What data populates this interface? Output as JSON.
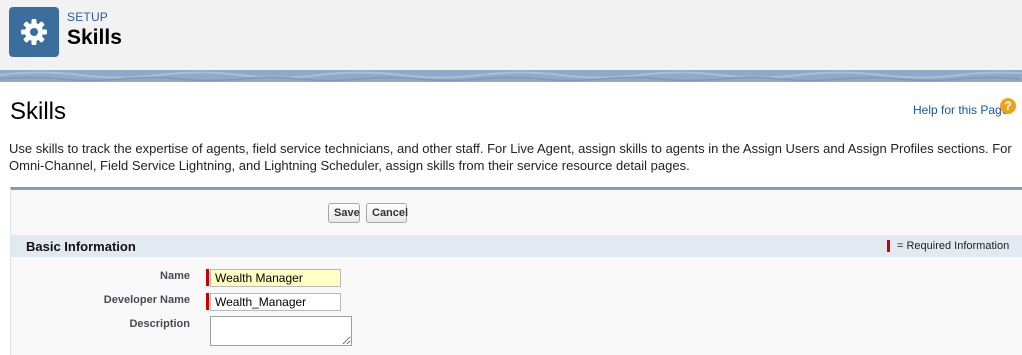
{
  "header": {
    "breadcrumb": "SETUP",
    "title": "Skills",
    "icon": "gear-icon",
    "icon_bg": "#3c6e9d"
  },
  "page": {
    "title": "Skills",
    "help_link": "Help for this Page",
    "help_icon": "question-icon",
    "description": "Use skills to track the expertise of agents, field service technicians, and other staff. For Live Agent, assign skills to agents in the Assign Users and Assign Profiles sections. For Omni-Channel, Field Service Lightning, and Lightning Scheduler, assign skills from their service resource detail pages."
  },
  "toolbar": {
    "save_label": "Save",
    "cancel_label": "Cancel"
  },
  "section": {
    "title": "Basic Information",
    "required_legend": "= Required Information"
  },
  "form": {
    "name_label": "Name",
    "name_value": "Wealth Manager",
    "developer_name_label": "Developer Name",
    "developer_name_value": "Wealth_Manager",
    "description_label": "Description",
    "description_value": ""
  },
  "colors": {
    "required": "#cc0000",
    "link": "#1a57a6",
    "highlight_input": "#ffffc4"
  }
}
